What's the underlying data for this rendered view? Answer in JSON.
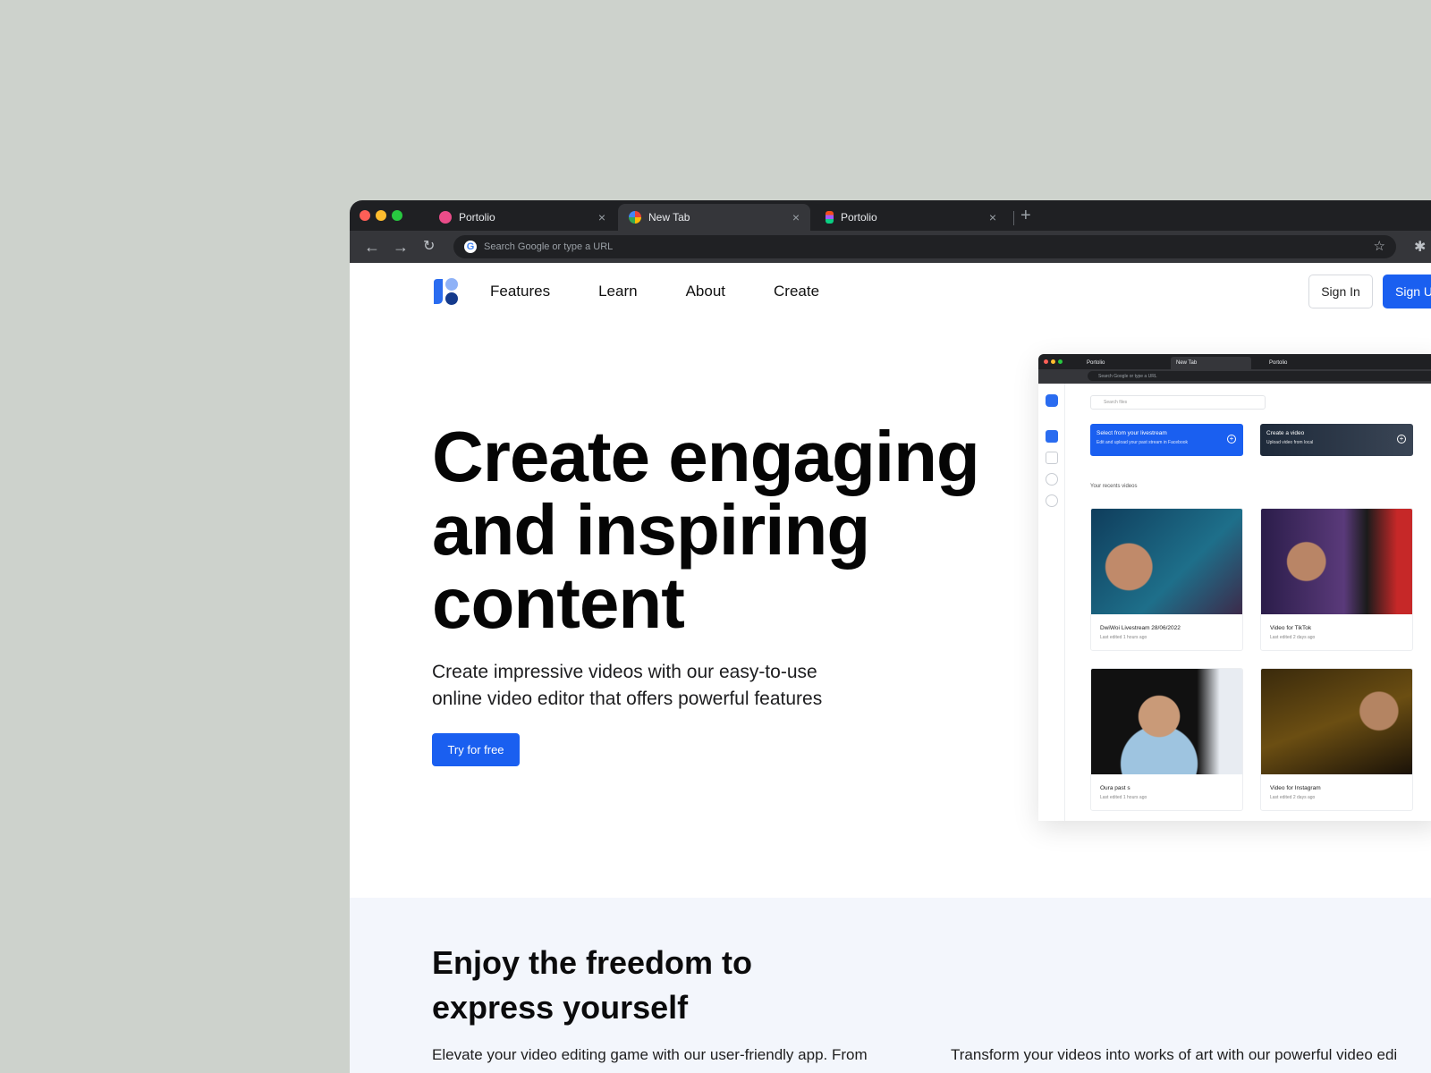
{
  "browser": {
    "tabs": [
      {
        "label": "Portolio",
        "icon": "dribbble-icon",
        "active": false
      },
      {
        "label": "New Tab",
        "icon": "google-icon",
        "active": true
      },
      {
        "label": "Portolio",
        "icon": "figma-icon",
        "active": false
      }
    ],
    "close_glyph": "×",
    "new_tab_glyph": "+",
    "omnibox_placeholder": "Search Google or type a URL"
  },
  "site": {
    "nav": [
      "Features",
      "Learn",
      "About",
      "Create"
    ],
    "sign_in": "Sign In",
    "sign_up": "Sign U",
    "hero": {
      "title": "Create engaging and inspiring content",
      "subtitle": "Create impressive videos with our easy-to-use online video editor that offers powerful features",
      "cta": "Try for free"
    },
    "preview": {
      "tabs": [
        "Portolio",
        "New Tab",
        "Portolio"
      ],
      "omnibox": "Search Google or type a URL",
      "search_placeholder": "Search files",
      "cards": [
        {
          "title": "Select from your livestream",
          "subtitle": "Edit and upload your past stream in Facebook"
        },
        {
          "title": "Create a video",
          "subtitle": "Upload video from local"
        }
      ],
      "recent_label": "Your recents videos",
      "videos": [
        {
          "title": "DwiWoi Livestream 28/06/2022",
          "edited": "Last edited 1 hours ago"
        },
        {
          "title": "Video for TikTok",
          "edited": "Last edited 2 days ago"
        },
        {
          "title": "Oura past s",
          "edited": "Last edited 1 hours ago"
        },
        {
          "title": "Video for Instagram",
          "edited": "Last edited 2 days ago"
        }
      ]
    },
    "freedom": {
      "title": "Enjoy the freedom to express yourself",
      "col1": "Elevate your video editing game with our user-friendly app. From",
      "col2": "Transform your videos into works of art with our powerful video edi"
    }
  },
  "colors": {
    "accent": "#1a5ff0",
    "background": "#cdd2cc",
    "browser_chrome": "#1f2023",
    "section_bg": "#f3f6fc"
  }
}
